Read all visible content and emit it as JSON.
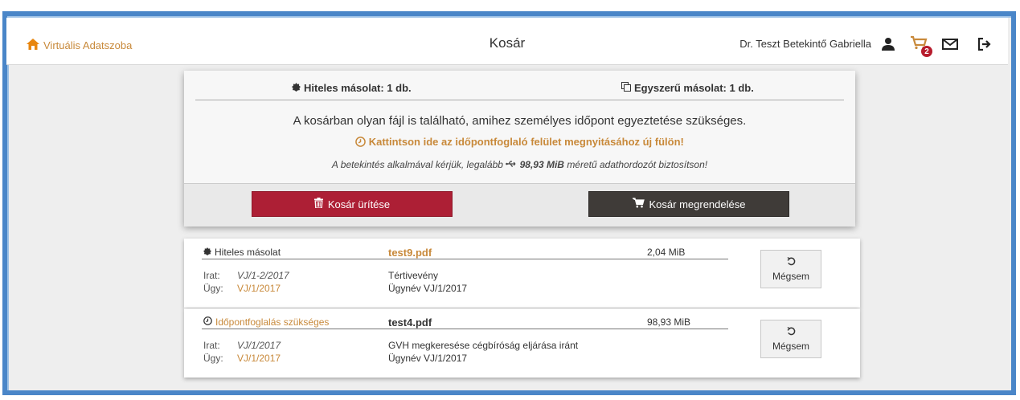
{
  "header": {
    "brand_label": "Virtuális Adatszoba",
    "title": "Kosár",
    "user_name": "Dr. Teszt Betekintő Gabriella",
    "cart_count": "2",
    "icons": [
      "home-icon",
      "user-icon",
      "cart-icon",
      "mail-icon",
      "logout-icon"
    ]
  },
  "summary": {
    "authentic_copies": "Hiteles másolat: 1 db.",
    "simple_copies": "Egyszerű másolat: 1 db.",
    "notice": "A kosárban olyan fájl is található, amihez személyes időpont egyeztetése szükséges.",
    "booking_link": "Kattintson ide az időpontfoglaló felület megnyitásához új fülön!",
    "note_prefix": "A betekintés alkalmával kérjük, legalább",
    "note_size": "98,93 MiB",
    "note_suffix": "méretű adathordozót biztosítson!",
    "empty_button": "Kosár ürítése",
    "order_button": "Kosár megrendelése"
  },
  "items": [
    {
      "type": "Hiteles másolat",
      "file": "test9.pdf",
      "size": "2,04 MiB",
      "irat_label": "Irat:",
      "irat": "VJ/1-2/2017",
      "ugy_label": "Ügy:",
      "ugy": "VJ/1/2017",
      "desc1": "Tértivevény",
      "desc2": "Ügynév VJ/1/2017",
      "cancel": "Mégsem"
    },
    {
      "type": "Időpontfoglalás szükséges",
      "file": "test4.pdf",
      "size": "98,93 MiB",
      "irat_label": "Irat:",
      "irat": "VJ/1/2017",
      "ugy_label": "Ügy:",
      "ugy": "VJ/1/2017",
      "desc1": "GVH megkeresése cégbíróság eljárása iránt",
      "desc2": "Ügynév VJ/1/2017",
      "cancel": "Mégsem"
    }
  ],
  "colors": {
    "accent": "#c8893a",
    "danger": "#ad1f35",
    "dark": "#3f3b38",
    "frame": "#4a86c8"
  }
}
